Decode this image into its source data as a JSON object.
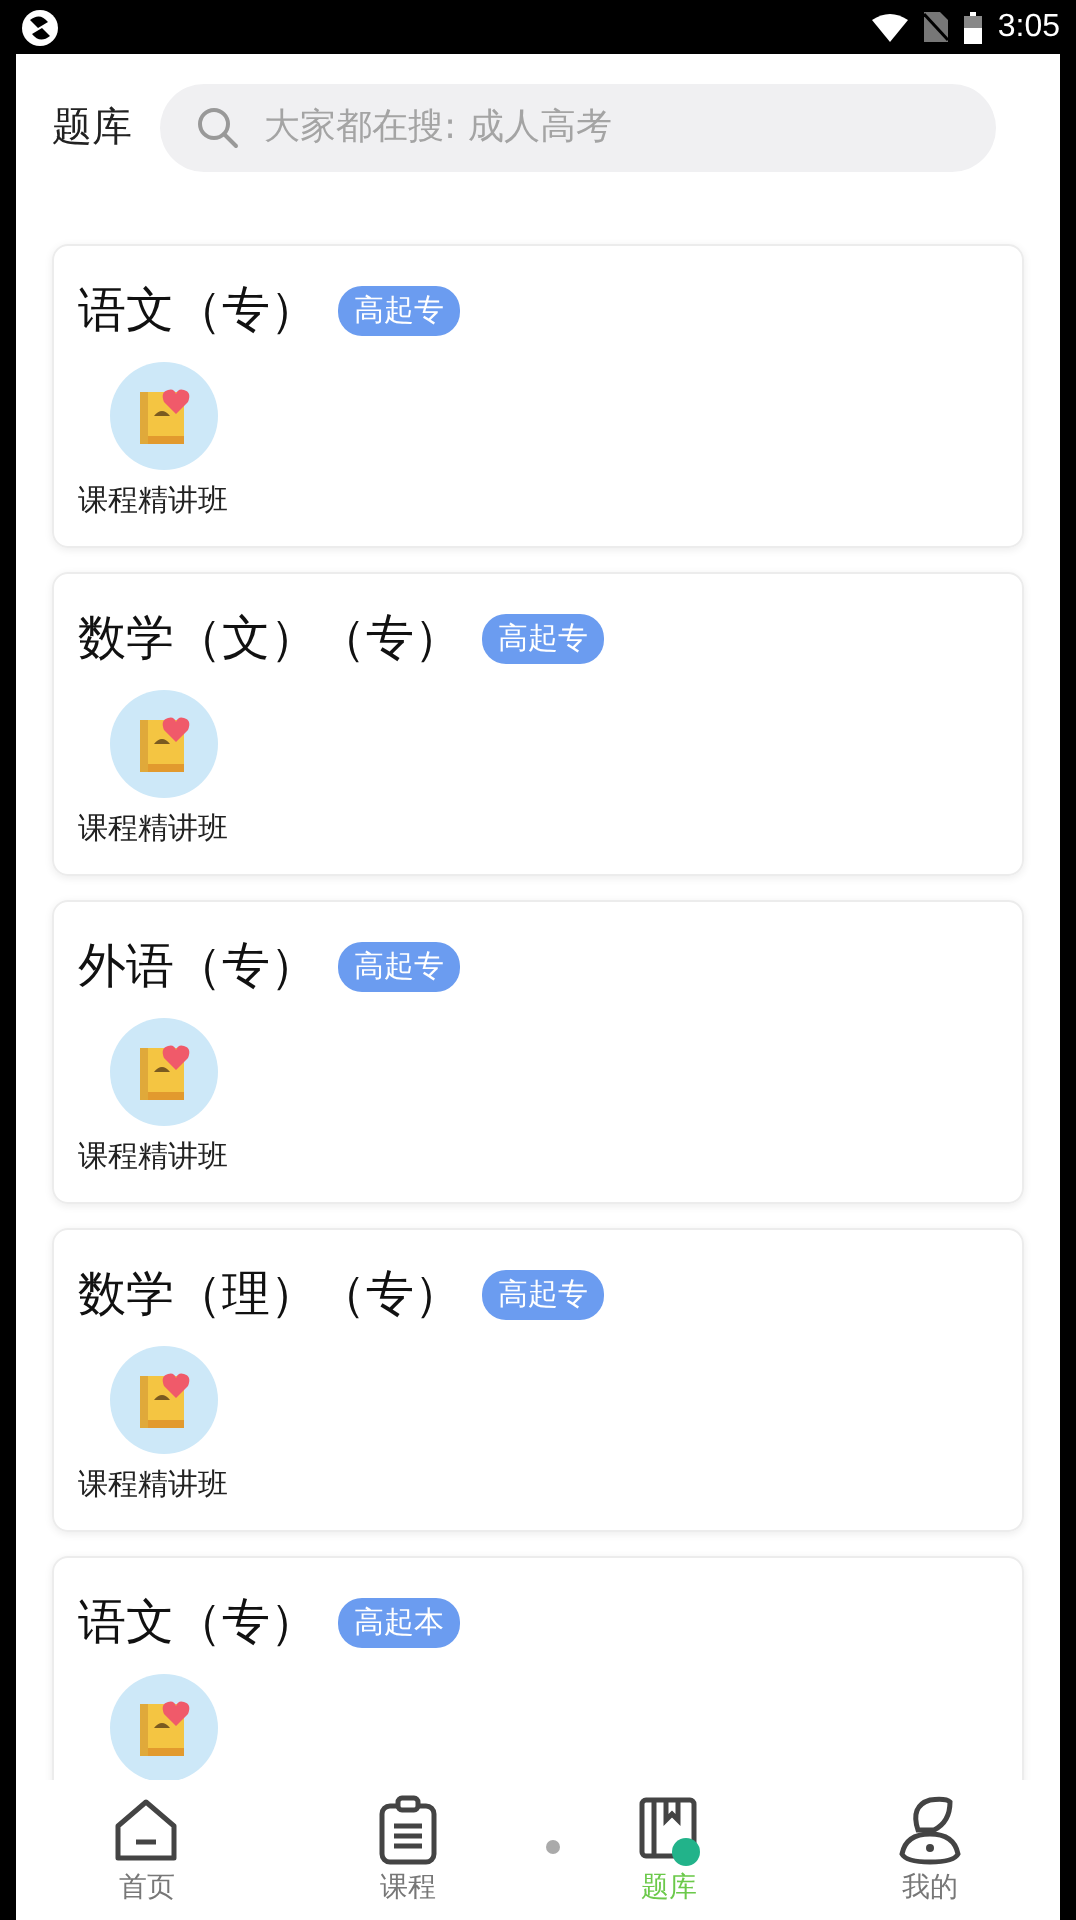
{
  "status_bar": {
    "time": "3:05"
  },
  "header": {
    "title": "题库",
    "search": {
      "placeholder": "大家都在搜: 成人高考"
    }
  },
  "subjects": [
    {
      "title": "语文（专）",
      "badge": "高起专",
      "course": "课程精讲班"
    },
    {
      "title": "数学（文）（专）",
      "badge": "高起专",
      "course": "课程精讲班"
    },
    {
      "title": "外语（专）",
      "badge": "高起专",
      "course": "课程精讲班"
    },
    {
      "title": "数学（理）（专）",
      "badge": "高起专",
      "course": "课程精讲班"
    },
    {
      "title": "语文（专）",
      "badge": "高起本"
    }
  ],
  "bottom_nav": [
    {
      "label": "首页",
      "selected": false
    },
    {
      "label": "课程",
      "selected": false
    },
    {
      "label": "题库",
      "selected": true
    },
    {
      "label": "我的",
      "selected": false
    }
  ]
}
